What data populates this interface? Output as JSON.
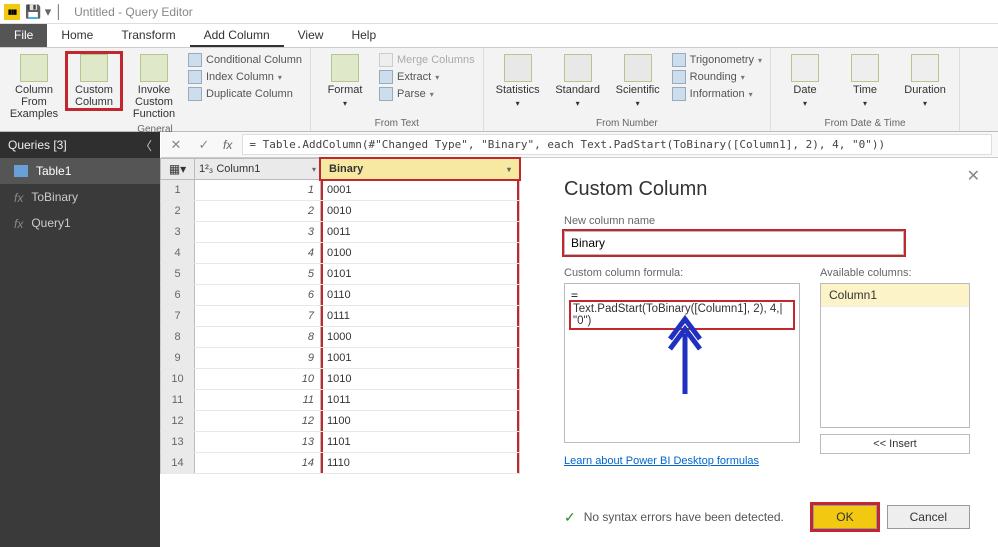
{
  "titlebar": {
    "title": "Untitled - Query Editor"
  },
  "menu": {
    "file": "File",
    "home": "Home",
    "transform": "Transform",
    "addcolumn": "Add Column",
    "view": "View",
    "help": "Help"
  },
  "ribbon": {
    "general": {
      "examples": "Column From\nExamples",
      "custom": "Custom\nColumn",
      "invoke": "Invoke Custom\nFunction",
      "cond": "Conditional Column",
      "index": "Index Column",
      "dup": "Duplicate Column",
      "label": "General"
    },
    "text": {
      "format": "Format",
      "merge": "Merge Columns",
      "extract": "Extract",
      "parse": "Parse",
      "label": "From Text"
    },
    "number": {
      "stats": "Statistics",
      "standard": "Standard",
      "sci": "Scientific",
      "trig": "Trigonometry",
      "round": "Rounding",
      "info": "Information",
      "label": "From Number"
    },
    "datetime": {
      "date": "Date",
      "time": "Time",
      "dur": "Duration",
      "label": "From Date & Time"
    }
  },
  "queries": {
    "header": "Queries [3]",
    "items": [
      {
        "label": "Table1",
        "kind": "table"
      },
      {
        "label": "ToBinary",
        "kind": "fn"
      },
      {
        "label": "Query1",
        "kind": "fn"
      }
    ]
  },
  "formula_bar": "= Table.AddColumn(#\"Changed Type\", \"Binary\", each Text.PadStart(ToBinary([Column1], 2), 4, \"0\"))",
  "grid": {
    "cols": [
      "",
      "1²₃ Column1",
      "Binary"
    ],
    "rows": [
      {
        "n": 1,
        "c1": "1",
        "c2": "0001"
      },
      {
        "n": 2,
        "c1": "2",
        "c2": "0010"
      },
      {
        "n": 3,
        "c1": "3",
        "c2": "0011"
      },
      {
        "n": 4,
        "c1": "4",
        "c2": "0100"
      },
      {
        "n": 5,
        "c1": "5",
        "c2": "0101"
      },
      {
        "n": 6,
        "c1": "6",
        "c2": "0110"
      },
      {
        "n": 7,
        "c1": "7",
        "c2": "0111"
      },
      {
        "n": 8,
        "c1": "8",
        "c2": "1000"
      },
      {
        "n": 9,
        "c1": "9",
        "c2": "1001"
      },
      {
        "n": 10,
        "c1": "10",
        "c2": "1010"
      },
      {
        "n": 11,
        "c1": "11",
        "c2": "1011"
      },
      {
        "n": 12,
        "c1": "12",
        "c2": "1100"
      },
      {
        "n": 13,
        "c1": "13",
        "c2": "1101"
      },
      {
        "n": 14,
        "c1": "14",
        "c2": "1110"
      }
    ]
  },
  "dialog": {
    "title": "Custom Column",
    "name_label": "New column name",
    "name_value": "Binary",
    "formula_label": "Custom column formula:",
    "formula_value": "Text.PadStart(ToBinary([Column1], 2), 4,| \"0\")",
    "avail_label": "Available columns:",
    "avail_items": [
      "Column1"
    ],
    "insert": "<< Insert",
    "learn": "Learn about Power BI Desktop formulas",
    "status": "No syntax errors have been detected.",
    "ok": "OK",
    "cancel": "Cancel"
  }
}
